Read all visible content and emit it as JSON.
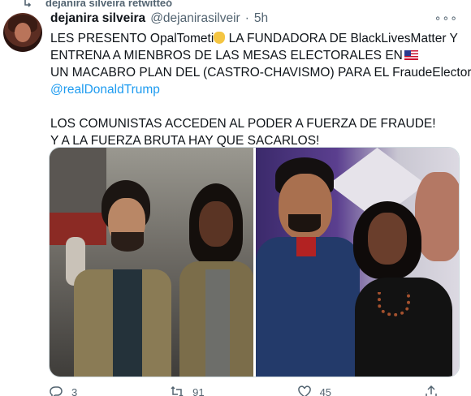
{
  "retweet": {
    "label": "dejanira silveira retwitteó",
    "icon": "retweet-icon"
  },
  "tweet": {
    "display_name": "dejanira silveira",
    "handle": "@dejanirasilveir",
    "separator": "·",
    "time": "5h",
    "more_icon": "more-icon",
    "more_label": "∘∘∘",
    "text_lines": {
      "l1a": "LES PRESENTO OpalTometi",
      "l1b": " LA FUNDADORA DE BlackLivesMatter Y",
      "l2": "ENTRENA A MIENBROS DE LAS MESAS ELECTORALES EN",
      "l3": "UN MACABRO PLAN DEL (CASTRO-CHAVISMO) PARA EL FraudeElectoral",
      "l4": "@realDonaldTrump",
      "l5": "LOS COMUNISTAS ACCEDEN AL PODER A FUERZA DE FRAUDE!",
      "l6": "Y A LA FUERZA BRUTA HAY QUE SACARLOS!"
    },
    "emoji": {
      "hand": "pointing-down-hand-emoji",
      "flag": "us-flag-emoji"
    },
    "link_color": "#1d9bf0"
  },
  "media": {
    "left_photo": "photo-man-and-woman-in-vests",
    "right_photo": "photo-man-and-woman-posing"
  },
  "actions": {
    "reply": {
      "icon": "reply-icon",
      "count": "3"
    },
    "retweet": {
      "icon": "retweet-icon",
      "count": "91"
    },
    "like": {
      "icon": "heart-icon",
      "count": "45"
    },
    "share": {
      "icon": "share-icon"
    }
  }
}
